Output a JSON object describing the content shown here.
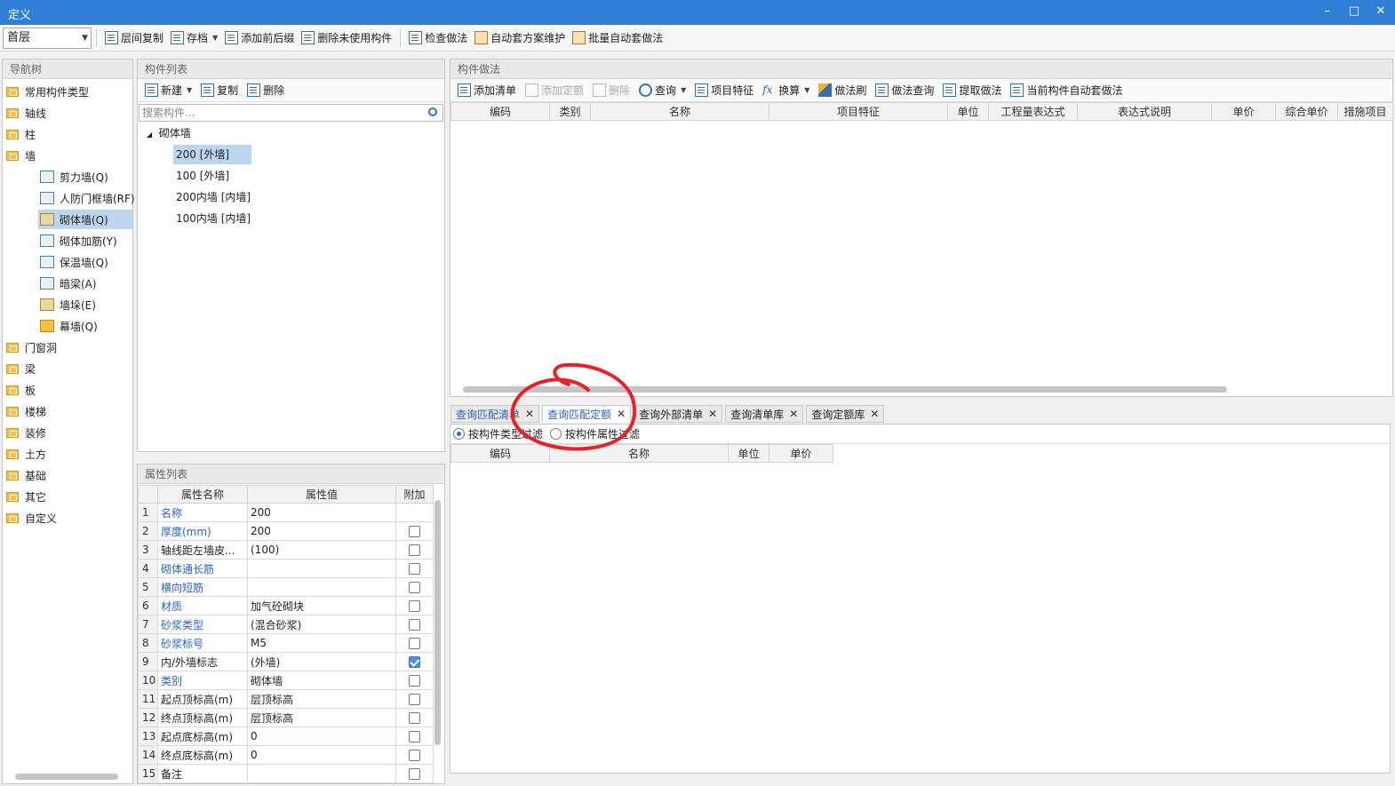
{
  "window": {
    "title": "定义",
    "min_icon": "minimize-icon",
    "max_icon": "maximize-icon",
    "close_icon": "close-icon"
  },
  "toolbar": {
    "floor": "首层",
    "buttons": [
      "层间复制",
      "存档",
      "添加前后缀",
      "删除未使用构件",
      "检查做法",
      "自动套方案维护",
      "批量自动套做法"
    ]
  },
  "nav": {
    "title": "导航树",
    "items": [
      "常用构件类型",
      "轴线",
      "柱",
      "墙",
      "门窗洞",
      "梁",
      "板",
      "楼梯",
      "装修",
      "土方",
      "基础",
      "其它",
      "自定义"
    ],
    "wall_children": [
      "剪力墙(Q)",
      "人防门框墙(RF)",
      "砌体墙(Q)",
      "砌体加筋(Y)",
      "保温墙(Q)",
      "暗梁(A)",
      "墙垛(E)",
      "幕墙(Q)"
    ],
    "selected_child": "砌体墙(Q)"
  },
  "component_list": {
    "title": "构件列表",
    "toolbar": [
      "新建",
      "复制",
      "删除"
    ],
    "search_placeholder": "搜索构件...",
    "root": "砌体墙",
    "items": [
      "200 [外墙]",
      "100 [外墙]",
      "200内墙 [内墙]",
      "100内墙 [内墙]"
    ]
  },
  "properties": {
    "title": "属性列表",
    "headers": [
      "属性名称",
      "属性值",
      "附加"
    ],
    "rows": [
      {
        "n": "1",
        "name": "名称",
        "value": "200",
        "blue": true,
        "check": null
      },
      {
        "n": "2",
        "name": "厚度(mm)",
        "value": "200",
        "blue": true,
        "check": false
      },
      {
        "n": "3",
        "name": "轴线距左墙皮...",
        "value": "(100)",
        "blue": false,
        "check": false
      },
      {
        "n": "4",
        "name": "砌体通长筋",
        "value": "",
        "blue": true,
        "check": false
      },
      {
        "n": "5",
        "name": "横向短筋",
        "value": "",
        "blue": true,
        "check": false
      },
      {
        "n": "6",
        "name": "材质",
        "value": "加气砼砌块",
        "blue": true,
        "check": false
      },
      {
        "n": "7",
        "name": "砂浆类型",
        "value": "(混合砂浆)",
        "blue": true,
        "check": false
      },
      {
        "n": "8",
        "name": "砂浆标号",
        "value": "M5",
        "blue": true,
        "check": false
      },
      {
        "n": "9",
        "name": "内/外墙标志",
        "value": "(外墙)",
        "blue": false,
        "check": true
      },
      {
        "n": "10",
        "name": "类别",
        "value": "砌体墙",
        "blue": true,
        "check": false
      },
      {
        "n": "11",
        "name": "起点顶标高(m)",
        "value": "层顶标高",
        "blue": false,
        "check": false
      },
      {
        "n": "12",
        "name": "终点顶标高(m)",
        "value": "层顶标高",
        "blue": false,
        "check": false
      },
      {
        "n": "13",
        "name": "起点底标高(m)",
        "value": "0",
        "blue": false,
        "check": false
      },
      {
        "n": "14",
        "name": "终点底标高(m)",
        "value": "0",
        "blue": false,
        "check": false
      },
      {
        "n": "15",
        "name": "备注",
        "value": "",
        "blue": false,
        "check": false
      }
    ]
  },
  "method": {
    "title": "构件做法",
    "toolbar": [
      "添加清单",
      "添加定额",
      "删除",
      "查询",
      "项目特征",
      "换算",
      "做法刷",
      "做法查询",
      "提取做法",
      "当前构件自动套做法"
    ],
    "headers": [
      "编码",
      "类别",
      "名称",
      "项目特征",
      "单位",
      "工程量表达式",
      "表达式说明",
      "单价",
      "综合单价",
      "措施项目"
    ]
  },
  "query": {
    "tabs": [
      "查询匹配清单",
      "查询匹配定额",
      "查询外部清单",
      "查询清单库",
      "查询定额库"
    ],
    "active_tab": "查询匹配定额",
    "filters": [
      "按构件类型过滤",
      "按构件属性过滤"
    ],
    "headers": [
      "编码",
      "名称",
      "单位",
      "单价"
    ]
  },
  "colors": {
    "titlebar": "#2f7fd6",
    "accent": "#2a62c9",
    "selection": "#bcd6f2",
    "annotation": "#e8202a"
  }
}
